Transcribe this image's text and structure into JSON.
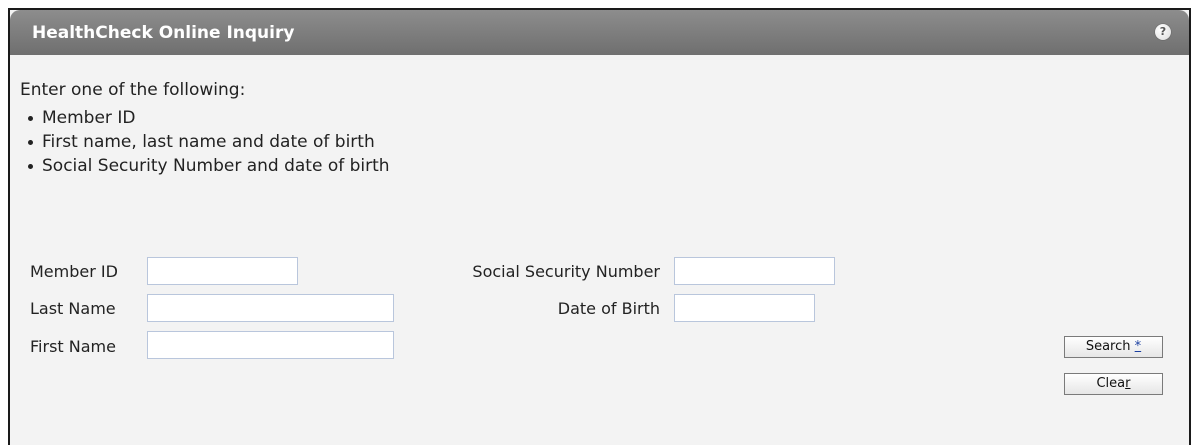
{
  "header": {
    "title": "HealthCheck Online Inquiry",
    "help_glyph": "?"
  },
  "instructions": {
    "intro": "Enter one of the following:",
    "items": [
      "Member ID",
      "First name, last name and date of birth",
      "Social Security Number and date of birth"
    ]
  },
  "form": {
    "member_id": {
      "label": "Member ID",
      "value": ""
    },
    "last_name": {
      "label": "Last Name",
      "value": ""
    },
    "first_name": {
      "label": "First Name",
      "value": ""
    },
    "ssn": {
      "label": "Social Security Number",
      "value": ""
    },
    "dob": {
      "label": "Date of Birth",
      "value": ""
    }
  },
  "buttons": {
    "search": {
      "label": "Search",
      "accelerator": "*"
    },
    "clear": {
      "label_prefix": "Clea",
      "accelerator": "r"
    }
  },
  "colors": {
    "header_bg": "#7f7f7f",
    "panel_bg": "#f3f3f3",
    "field_border": "#b9c6dc"
  }
}
